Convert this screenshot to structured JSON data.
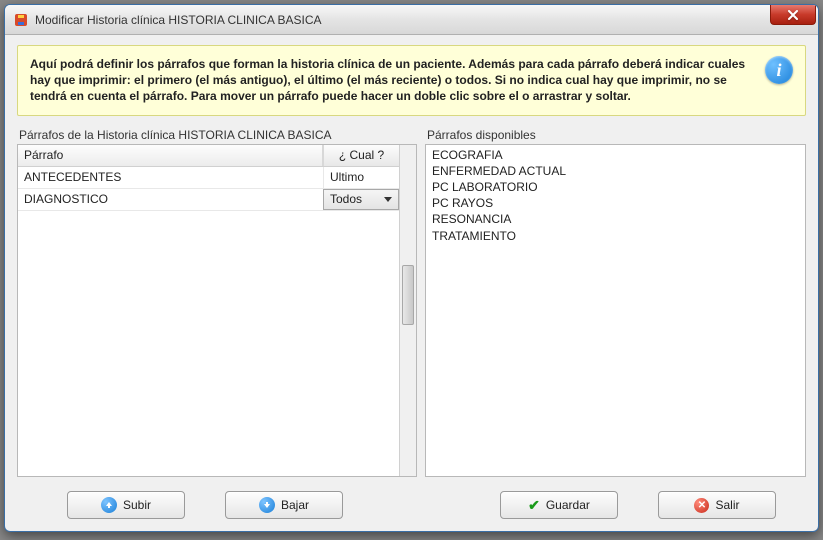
{
  "window": {
    "title": "Modificar Historia clínica HISTORIA CLINICA BASICA"
  },
  "banner": {
    "text": "Aquí podrá definir los párrafos que forman la historia clínica de un paciente. Además para cada párrafo deberá indicar cuales hay que imprimir: el primero (el más antiguo), el último (el más reciente) o todos. Si no indica cual hay que imprimir, no se tendrá en cuenta el párrafo. Para mover un párrafo puede hacer un doble clic sobre el o arrastrar y soltar."
  },
  "left_panel": {
    "label": "Párrafos de la Historia clínica HISTORIA CLINICA BASICA",
    "header_parrafo": "Párrafo",
    "header_cual": "¿ Cual ?",
    "rows": [
      {
        "parrafo": "ANTECEDENTES",
        "cual": "Ultimo",
        "is_dropdown": false
      },
      {
        "parrafo": "DIAGNOSTICO",
        "cual": "Todos",
        "is_dropdown": true
      }
    ]
  },
  "right_panel": {
    "label": "Párrafos disponibles",
    "items": [
      "ECOGRAFIA",
      "ENFERMEDAD ACTUAL",
      "PC LABORATORIO",
      "PC RAYOS",
      "RESONANCIA",
      "TRATAMIENTO"
    ]
  },
  "buttons": {
    "subir": "Subir",
    "bajar": "Bajar",
    "guardar": "Guardar",
    "salir": "Salir"
  }
}
